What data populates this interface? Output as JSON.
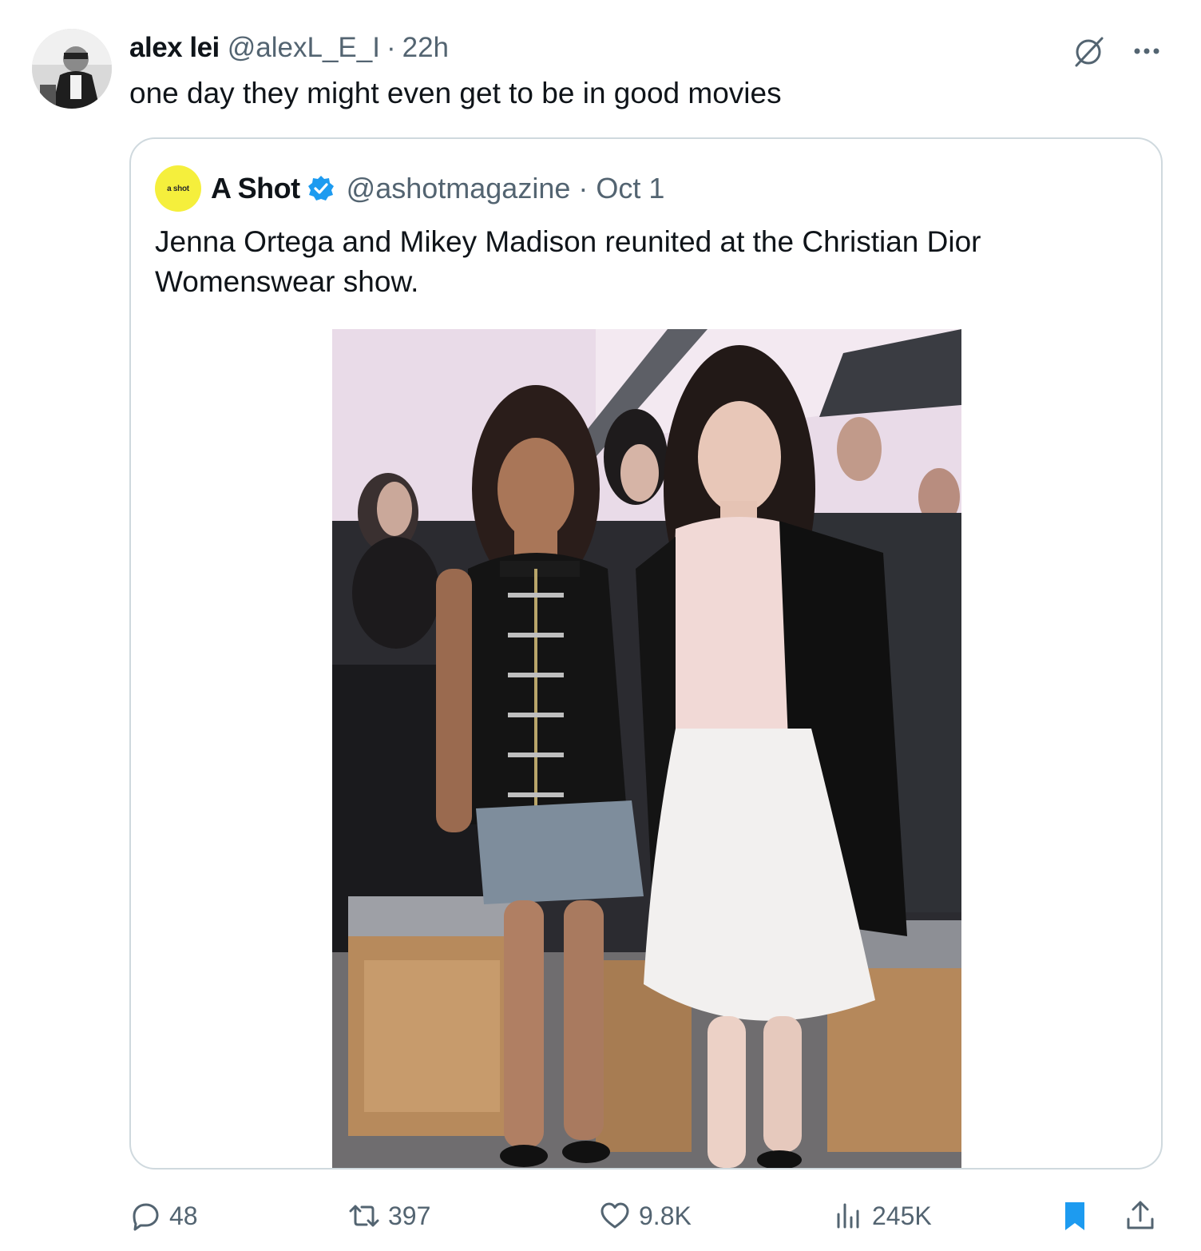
{
  "tweet": {
    "author": {
      "display_name": "alex lei",
      "handle": "@alexL_E_I",
      "separator": "·",
      "time": "22h"
    },
    "text": "one day they might even get to be in good movies",
    "icons": {
      "grok": "slash-circle-icon",
      "more": "more-dots-icon"
    }
  },
  "quote": {
    "avatar_text": "a shot",
    "display_name": "A Shot",
    "verified_color": "#1d9bf0",
    "handle": "@ashotmagazine",
    "separator": "·",
    "date": "Oct 1",
    "text": "Jenna Ortega and Mikey Madison reunited at the Christian Dior Womenswear show."
  },
  "actions": {
    "replies": "48",
    "reposts": "397",
    "likes": "9.8K",
    "views": "245K",
    "bookmark_color": "#1d9bf0"
  }
}
